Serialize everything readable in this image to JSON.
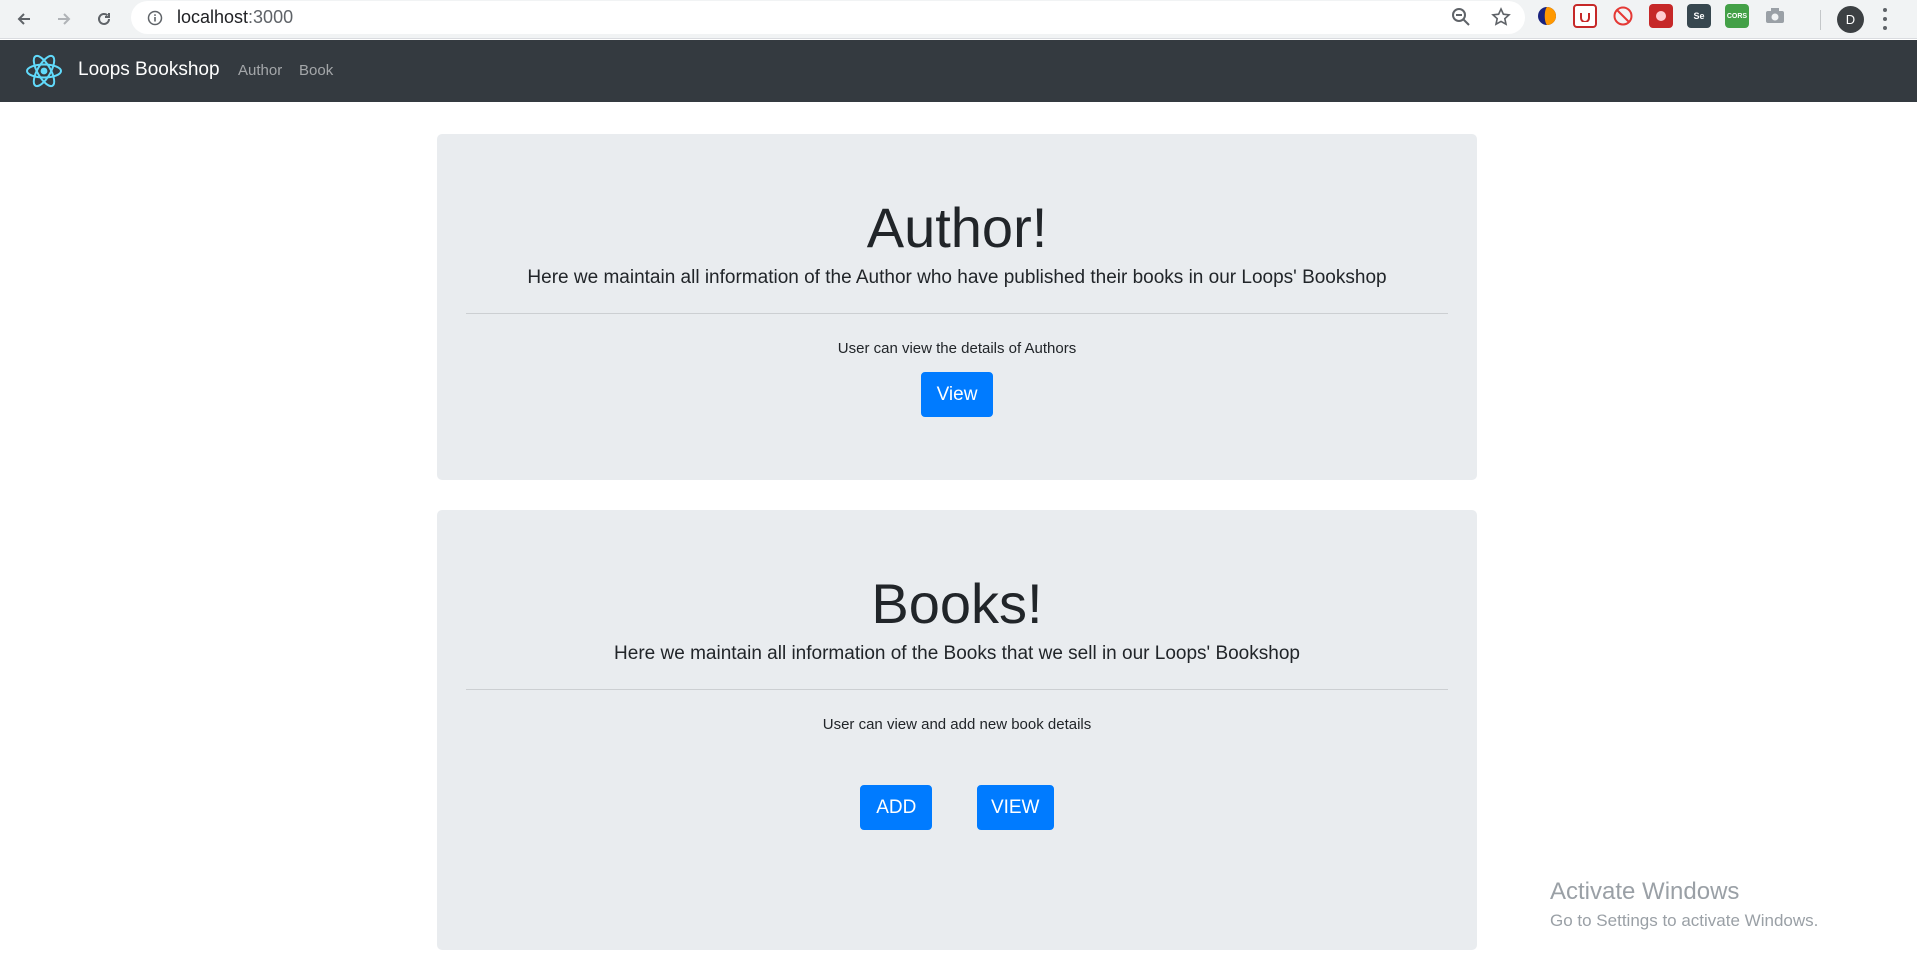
{
  "browser": {
    "url_host": "localhost",
    "url_port": ":3000",
    "profile_initial": "D",
    "extensions": [
      {
        "icon": "pocket-extension-icon",
        "color": "#e0e0e0",
        "label": ""
      },
      {
        "icon": "ublock-extension-icon",
        "color": "#ffffff",
        "label": ""
      },
      {
        "icon": "no-entry-extension-icon",
        "color": "#ffffff",
        "label": ""
      },
      {
        "icon": "red-extension-icon",
        "color": "#c62828",
        "label": ""
      },
      {
        "icon": "selenium-extension-icon",
        "color": "#37474f",
        "label": "Se"
      },
      {
        "icon": "cors-extension-icon",
        "color": "#43a047",
        "label": "CORS"
      },
      {
        "icon": "camera-extension-icon",
        "color": "#f1f3f4",
        "label": ""
      }
    ]
  },
  "navbar": {
    "brand": "Loops Bookshop",
    "links": [
      "Author",
      "Book"
    ]
  },
  "author_section": {
    "title": "Author!",
    "lead_prefix": "Here we maintain all information of the Author who have published their books in our ",
    "lead_emphasis": "Loops' Bookshop",
    "description": "User can view the details of Authors",
    "view_button": "View"
  },
  "books_section": {
    "title": "Books!",
    "lead_prefix": "Here we maintain all information of the Books that we sell in our ",
    "lead_emphasis": "Loops' Bookshop",
    "description": "User can view and add new book details",
    "add_button": "ADD",
    "view_button": "VIEW"
  },
  "os_watermark": {
    "title": "Activate Windows",
    "subtitle": "Go to Settings to activate Windows."
  },
  "colors": {
    "navbar_bg": "#343a40",
    "jumbotron_bg": "#e9ecef",
    "primary_button": "#007bff",
    "react_logo": "#61dafb"
  }
}
